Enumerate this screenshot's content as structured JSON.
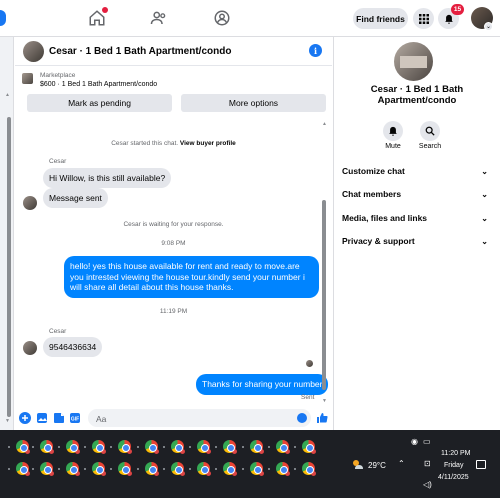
{
  "topnav": {
    "find_friends_label": "Find friends",
    "notification_count": "15"
  },
  "chat": {
    "title": "Cesar · 1 Bed 1 Bath Apartment/condo",
    "marketplace_label": "Marketplace",
    "marketplace_item": "$600 · 1 Bed 1 Bath Apartment/condo",
    "mark_pending_label": "Mark as pending",
    "more_options_label": "More options",
    "started_text": "Cesar started this chat.",
    "view_buyer_profile": "View buyer profile",
    "sender_name_1": "Cesar",
    "msg_in_1": "Hi Willow, is this still available?",
    "msg_in_2": "Message sent",
    "waiting_text": "Cesar is waiting for your response.",
    "time_1": "9:08 PM",
    "msg_out_1": "hello! yes this house available for rent and ready to move.are you intrested viewing the house tour.kindly send your number i will share all detail about this house thanks.",
    "time_2": "11:19 PM",
    "sender_name_2": "Cesar",
    "msg_in_3": "9546436634",
    "msg_out_2": "Thanks for sharing your number",
    "sent_status": "Sent",
    "composer_placeholder": "Aa"
  },
  "right_panel": {
    "name": "Cesar · 1 Bed 1 Bath Apartment/condo",
    "mute_label": "Mute",
    "search_label": "Search",
    "items": [
      {
        "label": "Customize chat"
      },
      {
        "label": "Chat members"
      },
      {
        "label": "Media, files and links"
      },
      {
        "label": "Privacy & support"
      }
    ]
  },
  "taskbar": {
    "temperature": "29°C",
    "time": "11:20 PM",
    "day": "Friday",
    "date": "4/11/2025"
  },
  "colors": {
    "accent": "#1877f2",
    "bubble_out": "#0084ff",
    "bubble_in": "#e4e6eb",
    "badge": "#e41e3f",
    "taskbar": "#1d1f24"
  },
  "icons": [
    "home-icon",
    "friends-icon",
    "groups-icon",
    "menu-grid-icon",
    "bell-icon",
    "info-icon",
    "bell-mute-icon",
    "search-icon",
    "plus-icon",
    "image-icon",
    "sticker-icon",
    "gif-icon",
    "emoji-icon",
    "like-icon",
    "chrome-icon",
    "weather-icon"
  ]
}
